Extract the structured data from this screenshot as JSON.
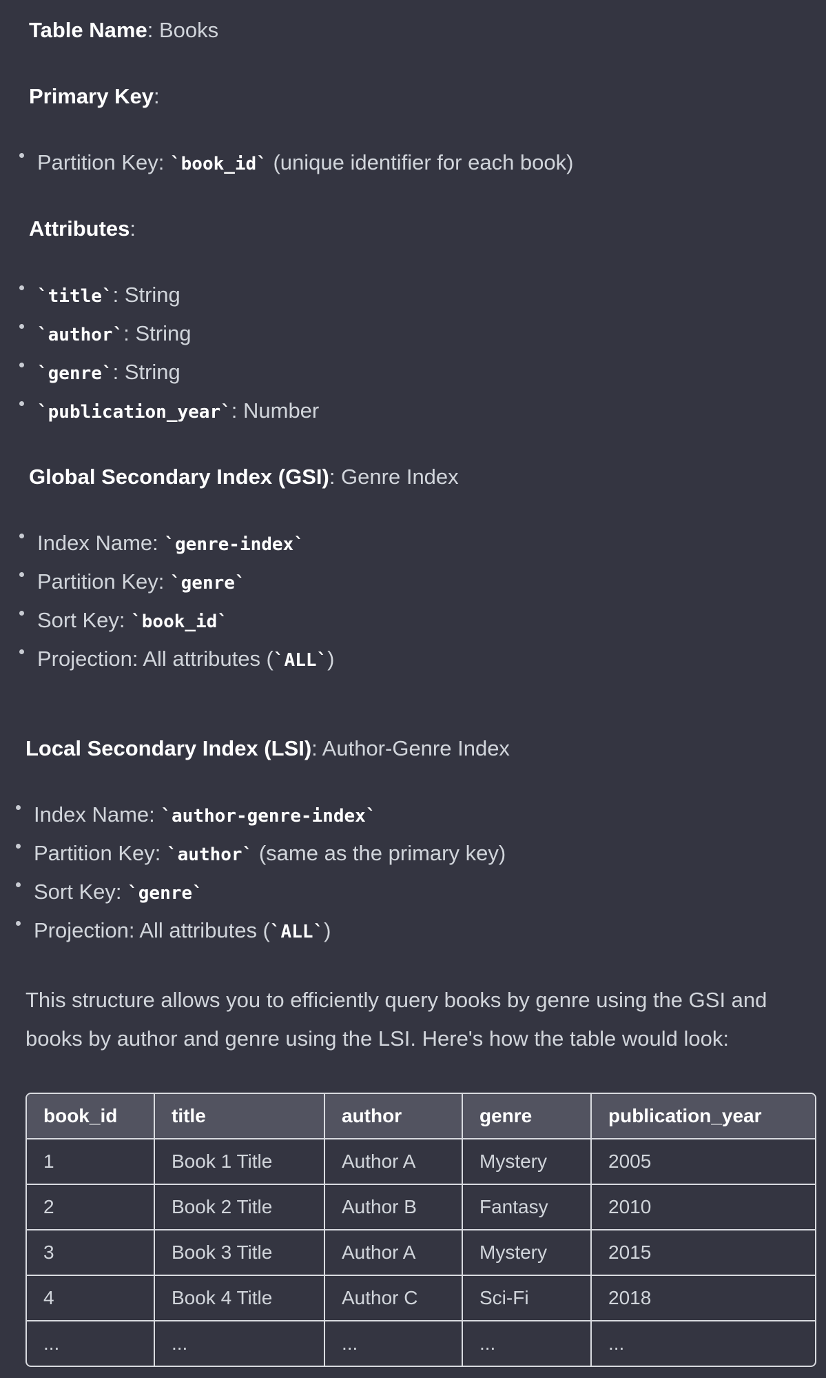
{
  "table_name": {
    "label": "Table Name",
    "value": ": Books"
  },
  "primary_key": {
    "label": "Primary Key",
    "suffix": ":",
    "items": [
      {
        "prefix": "Partition Key: ",
        "code": "`book_id`",
        "suffix": " (unique identifier for each book)"
      }
    ]
  },
  "attributes": {
    "label": "Attributes",
    "suffix": ":",
    "items": [
      {
        "prefix": "",
        "code": "`title`",
        "suffix": ": String"
      },
      {
        "prefix": "",
        "code": "`author`",
        "suffix": ": String"
      },
      {
        "prefix": "",
        "code": "`genre`",
        "suffix": ": String"
      },
      {
        "prefix": "",
        "code": "`publication_year`",
        "suffix": ": Number"
      }
    ]
  },
  "gsi": {
    "label": "Global Secondary Index (GSI)",
    "suffix": ": Genre Index",
    "items": [
      {
        "prefix": "Index Name: ",
        "code": "`genre-index`",
        "suffix": ""
      },
      {
        "prefix": "Partition Key: ",
        "code": "`genre`",
        "suffix": ""
      },
      {
        "prefix": "Sort Key: ",
        "code": "`book_id`",
        "suffix": ""
      },
      {
        "prefix": "Projection: All attributes (",
        "code": "`ALL`",
        "suffix": ")"
      }
    ]
  },
  "lsi": {
    "label": "Local Secondary Index (LSI)",
    "suffix": ": Author-Genre Index",
    "items": [
      {
        "prefix": "Index Name: ",
        "code": "`author-genre-index`",
        "suffix": ""
      },
      {
        "prefix": "Partition Key: ",
        "code": "`author`",
        "suffix": " (same as the primary key)"
      },
      {
        "prefix": "Sort Key: ",
        "code": "`genre`",
        "suffix": ""
      },
      {
        "prefix": "Projection: All attributes (",
        "code": "`ALL`",
        "suffix": ")"
      }
    ]
  },
  "summary": "This structure allows you to efficiently query books by genre using the GSI and books by author and genre using the LSI. Here's how the table would look:",
  "table": {
    "headers": [
      "book_id",
      "title",
      "author",
      "genre",
      "publication_year"
    ],
    "rows": [
      [
        "1",
        "Book 1 Title",
        "Author A",
        "Mystery",
        "2005"
      ],
      [
        "2",
        "Book 2 Title",
        "Author B",
        "Fantasy",
        "2010"
      ],
      [
        "3",
        "Book 3 Title",
        "Author A",
        "Mystery",
        "2015"
      ],
      [
        "4",
        "Book 4 Title",
        "Author C",
        "Sci-Fi",
        "2018"
      ],
      [
        "...",
        "...",
        "...",
        "...",
        "..."
      ]
    ]
  }
}
